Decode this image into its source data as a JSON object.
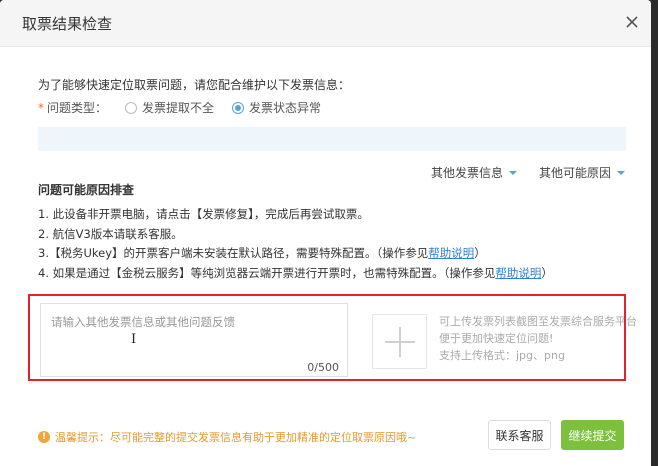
{
  "dialog": {
    "title": "取票结果检查",
    "intro": "为了能够快速定位取票问题，请您配合维护以下发票信息：",
    "type_label": "问题类型：",
    "type_options": [
      {
        "label": "发票提取不全",
        "selected": false
      },
      {
        "label": "发票状态异常",
        "selected": true
      }
    ],
    "dropdowns": [
      "其他发票信息",
      "其他可能原因"
    ],
    "diag_title": "问题可能原因排查",
    "steps": [
      {
        "text": "1. 此设备非开票电脑，请点击【发票修复】，完成后再尝试取票。"
      },
      {
        "text": "2. 航信V3版本请联系客服。"
      },
      {
        "text": "3.【税务Ukey】的开票客户端未安装在默认路径，需要特殊配置。（操作参见",
        "link": "帮助说明",
        "suffix": "）"
      },
      {
        "text": "4. 如果是通过【金税云服务】等纯浏览器云端开票进行开票时，也需特殊配置。（操作参见",
        "link": "帮助说明",
        "suffix": "）"
      }
    ],
    "feedback": {
      "placeholder": "请输入其他发票信息或其他问题反馈",
      "count": "0/500"
    },
    "upload_tip": [
      "可上传发票列表截图至发票综合服务平台",
      "便于更加快速定位问题!",
      "支持上传格式：jpg、png"
    ],
    "footer_tip": "温馨提示：尽可能完整的提交发票信息有助于更加精准的定位取票原因哦~",
    "buttons": {
      "service": "联系客服",
      "submit": "继续提交"
    }
  },
  "colors": {
    "accent": "#57a3d9",
    "submit": "#7cc03d",
    "warning": "#e59a2c",
    "highlight": "#e4222a",
    "link": "#2f7fd1"
  }
}
